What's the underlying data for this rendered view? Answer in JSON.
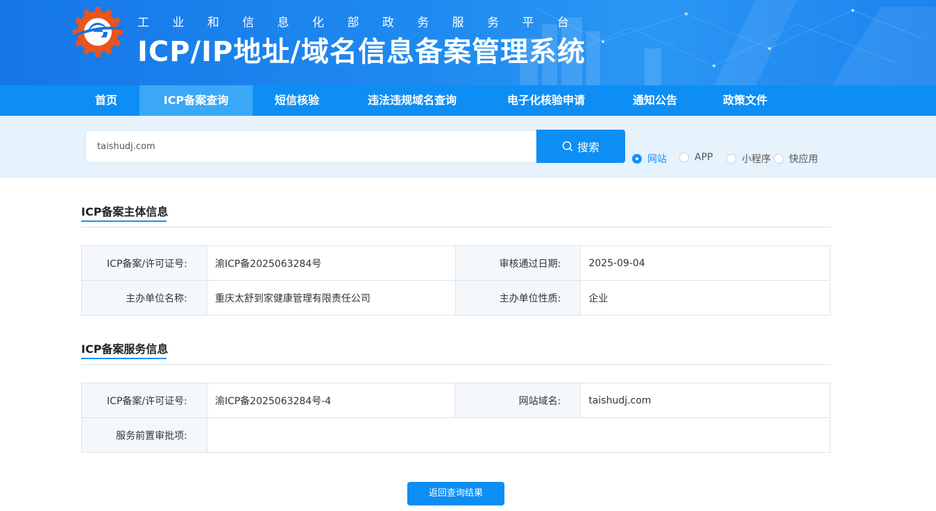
{
  "header": {
    "subtitle_chars": [
      "工",
      "业",
      "和",
      "信",
      "息",
      "化",
      "部",
      "政",
      "务",
      "服",
      "务",
      "平",
      "台"
    ],
    "title": "ICP/IP地址/域名信息备案管理系统"
  },
  "nav": {
    "items": [
      {
        "label": "首页"
      },
      {
        "label": "ICP备案查询",
        "active": true
      },
      {
        "label": "短信核验"
      },
      {
        "label": "违法违规域名查询"
      },
      {
        "label": "电子化核验申请"
      },
      {
        "label": "通知公告"
      },
      {
        "label": "政策文件"
      }
    ]
  },
  "search": {
    "value": "taishudj.com",
    "button_label": "搜索",
    "types": [
      {
        "label": "网站",
        "checked": true
      },
      {
        "label": "APP",
        "checked": false
      },
      {
        "label": "小程序",
        "checked": false
      },
      {
        "label": "快应用",
        "checked": false
      }
    ]
  },
  "subject_section": {
    "title": "ICP备案主体信息",
    "rows": [
      {
        "k1": "ICP备案/许可证号:",
        "v1": "渝ICP备2025063284号",
        "k2": "审核通过日期:",
        "v2": "2025-09-04"
      },
      {
        "k1": "主办单位名称:",
        "v1": "重庆太舒到家健康管理有限责任公司",
        "k2": "主办单位性质:",
        "v2": "企业"
      }
    ]
  },
  "service_section": {
    "title": "ICP备案服务信息",
    "row1": {
      "k1": "ICP备案/许可证号:",
      "v1": "渝ICP备2025063284号-4",
      "k2": "网站域名:",
      "v2": "taishudj.com"
    },
    "row2": {
      "k1": "服务前置审批项:",
      "v1": ""
    }
  },
  "footer": {
    "back_label": "返回查询结果"
  },
  "colors": {
    "primary": "#0d8ef5",
    "nav_active": "#3aa8f7",
    "accent": "#1890ff"
  }
}
